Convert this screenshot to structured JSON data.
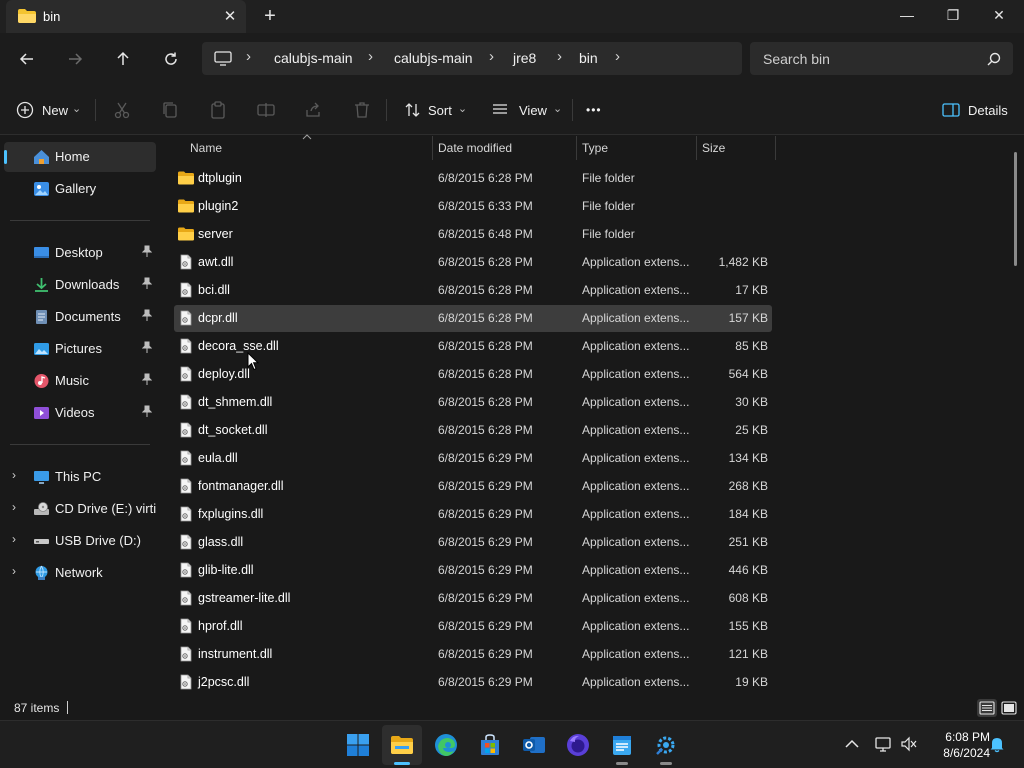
{
  "window": {
    "tab_title": "bin",
    "tab_close": "✕",
    "new_tab": "+",
    "minimize": "—",
    "maximize": "❐",
    "close": "✕"
  },
  "address": {
    "crumbs": [
      "calubjs-main",
      "calubjs-main",
      "jre8",
      "bin"
    ],
    "sep": "›",
    "search_placeholder": "Search bin"
  },
  "toolbar": {
    "new_label": "New",
    "sort_label": "Sort",
    "view_label": "View",
    "more_label": "•••",
    "details_label": "Details",
    "caret": "⌄"
  },
  "sidebar": {
    "home": "Home",
    "gallery": "Gallery",
    "desktop": "Desktop",
    "downloads": "Downloads",
    "documents": "Documents",
    "pictures": "Pictures",
    "music": "Music",
    "videos": "Videos",
    "this_pc": "This PC",
    "cd_drive": "CD Drive (E:) virtio-",
    "usb_drive": "USB Drive (D:)",
    "network": "Network",
    "chevron": "›",
    "pin": "📌"
  },
  "columns": {
    "name": "Name",
    "date": "Date modified",
    "type": "Type",
    "size": "Size"
  },
  "files": [
    {
      "name": "dtplugin",
      "date": "6/8/2015 6:28 PM",
      "type": "File folder",
      "size": ""
    },
    {
      "name": "plugin2",
      "date": "6/8/2015 6:33 PM",
      "type": "File folder",
      "size": ""
    },
    {
      "name": "server",
      "date": "6/8/2015 6:48 PM",
      "type": "File folder",
      "size": ""
    },
    {
      "name": "awt.dll",
      "date": "6/8/2015 6:28 PM",
      "type": "Application extens...",
      "size": "1,482 KB"
    },
    {
      "name": "bci.dll",
      "date": "6/8/2015 6:28 PM",
      "type": "Application extens...",
      "size": "17 KB"
    },
    {
      "name": "dcpr.dll",
      "date": "6/8/2015 6:28 PM",
      "type": "Application extens...",
      "size": "157 KB"
    },
    {
      "name": "decora_sse.dll",
      "date": "6/8/2015 6:28 PM",
      "type": "Application extens...",
      "size": "85 KB"
    },
    {
      "name": "deploy.dll",
      "date": "6/8/2015 6:28 PM",
      "type": "Application extens...",
      "size": "564 KB"
    },
    {
      "name": "dt_shmem.dll",
      "date": "6/8/2015 6:28 PM",
      "type": "Application extens...",
      "size": "30 KB"
    },
    {
      "name": "dt_socket.dll",
      "date": "6/8/2015 6:28 PM",
      "type": "Application extens...",
      "size": "25 KB"
    },
    {
      "name": "eula.dll",
      "date": "6/8/2015 6:29 PM",
      "type": "Application extens...",
      "size": "134 KB"
    },
    {
      "name": "fontmanager.dll",
      "date": "6/8/2015 6:29 PM",
      "type": "Application extens...",
      "size": "268 KB"
    },
    {
      "name": "fxplugins.dll",
      "date": "6/8/2015 6:29 PM",
      "type": "Application extens...",
      "size": "184 KB"
    },
    {
      "name": "glass.dll",
      "date": "6/8/2015 6:29 PM",
      "type": "Application extens...",
      "size": "251 KB"
    },
    {
      "name": "glib-lite.dll",
      "date": "6/8/2015 6:29 PM",
      "type": "Application extens...",
      "size": "446 KB"
    },
    {
      "name": "gstreamer-lite.dll",
      "date": "6/8/2015 6:29 PM",
      "type": "Application extens...",
      "size": "608 KB"
    },
    {
      "name": "hprof.dll",
      "date": "6/8/2015 6:29 PM",
      "type": "Application extens...",
      "size": "155 KB"
    },
    {
      "name": "instrument.dll",
      "date": "6/8/2015 6:29 PM",
      "type": "Application extens...",
      "size": "121 KB"
    },
    {
      "name": "j2pcsc.dll",
      "date": "6/8/2015 6:29 PM",
      "type": "Application extens...",
      "size": "19 KB"
    }
  ],
  "status": {
    "item_count": "87 items"
  },
  "clock": {
    "time": "6:08 PM",
    "date": "8/6/2024"
  },
  "colors": {
    "accent": "#4cc2ff",
    "folder": "#f4c430",
    "selected_row": "#3d3d3d",
    "background": "#191919"
  },
  "icons": {
    "back": "arrow-left-icon",
    "forward": "arrow-right-icon",
    "up": "arrow-up-icon",
    "refresh": "refresh-icon",
    "search": "search-icon",
    "folder": "folder-icon",
    "dll": "dll-file-icon"
  }
}
